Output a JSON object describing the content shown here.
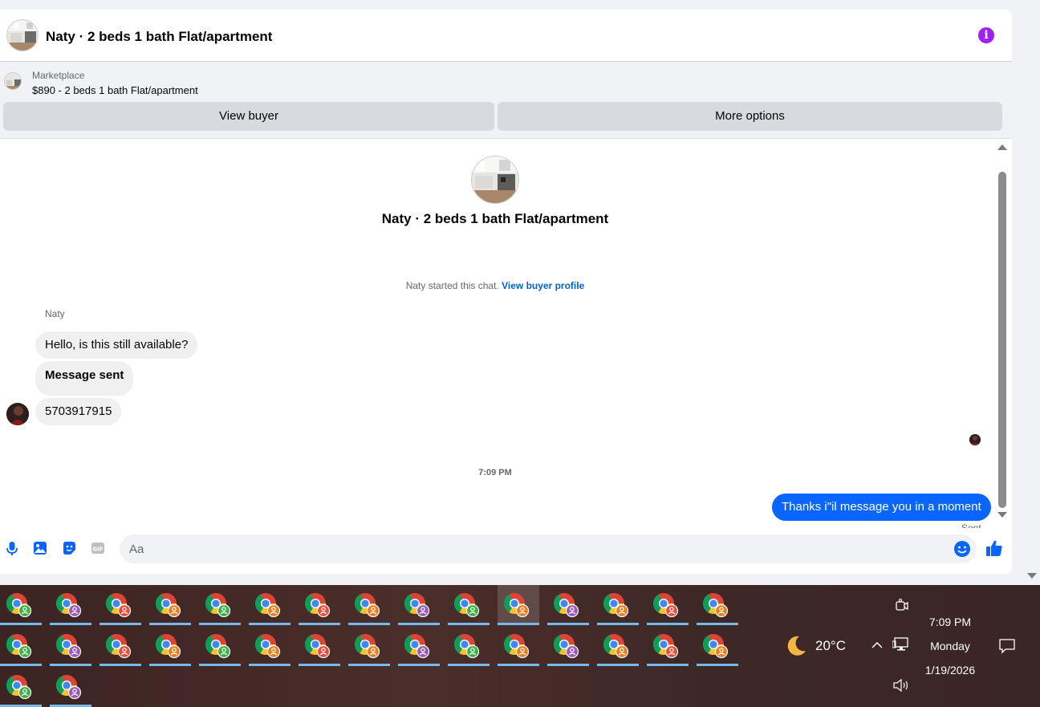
{
  "header": {
    "title": "Naty · 2 beds 1 bath Flat/apartment"
  },
  "listing": {
    "label": "Marketplace",
    "price_title": "$890 - 2 beds 1 bath Flat/apartment",
    "view_buyer_label": "View buyer",
    "more_options_label": "More options"
  },
  "conversation": {
    "title": "Naty · 2 beds 1 bath Flat/apartment",
    "system_text": "Naty started this chat.",
    "system_link": "View buyer profile",
    "sender_name": "Naty",
    "incoming": [
      "Hello, is this still available?",
      "Message sent",
      "5703917915"
    ],
    "timestamp": "7:09 PM",
    "outgoing": "Thanks i\"il message you in a moment",
    "sent_status": "Sent"
  },
  "composer": {
    "placeholder": "Aa"
  },
  "taskbar": {
    "temperature": "20°C",
    "time": "7:09 PM",
    "day": "Monday",
    "date": "1/19/2026"
  },
  "colors": {
    "accent": "#0866ff",
    "info": "#a020f0",
    "taskbar_underline": "#76b9ed"
  }
}
